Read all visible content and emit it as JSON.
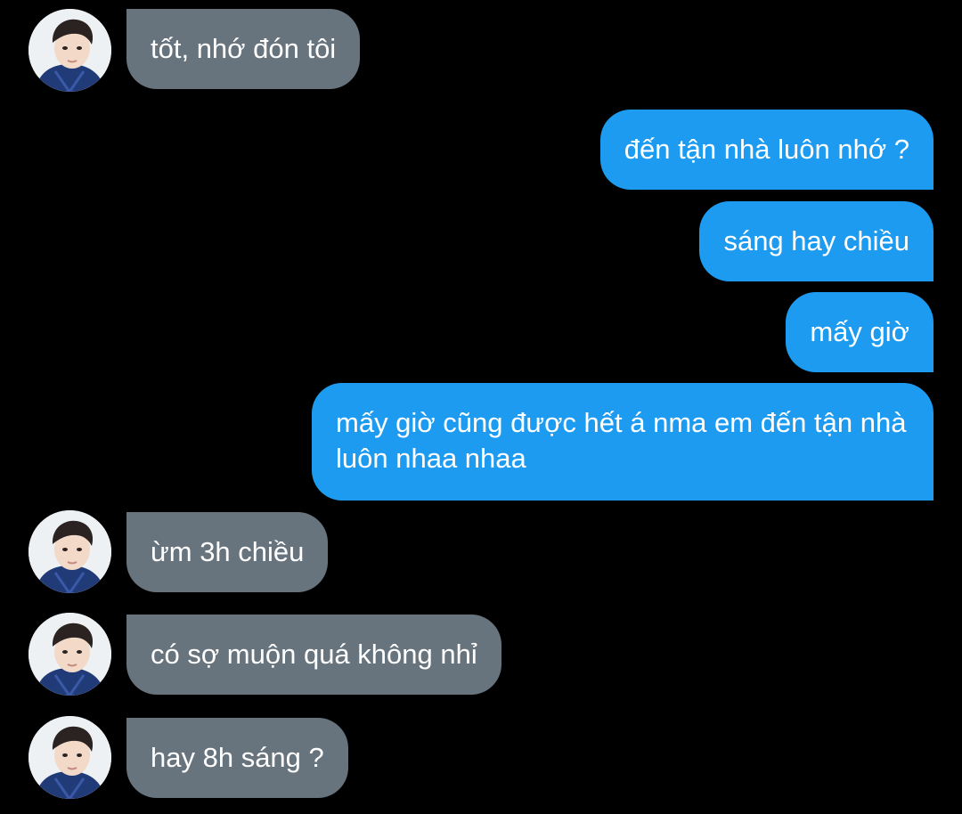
{
  "colors": {
    "background": "#000000",
    "incoming_bubble": "#67737d",
    "outgoing_bubble": "#1d9bf0",
    "text": "#ffffff"
  },
  "contact": {
    "avatar_icon": "contact-avatar-photo"
  },
  "messages": [
    {
      "direction": "incoming",
      "text": "tốt, nhớ đón tôi"
    },
    {
      "direction": "outgoing",
      "text": "đến tận nhà luôn nhớ ?"
    },
    {
      "direction": "outgoing",
      "text": "sáng hay chiều"
    },
    {
      "direction": "outgoing",
      "text": "mấy giờ"
    },
    {
      "direction": "outgoing",
      "text": "mấy giờ cũng được hết á nma em đến tận nhà luôn nhaa nhaa"
    },
    {
      "direction": "incoming",
      "text": "ừm 3h chiều"
    },
    {
      "direction": "incoming",
      "text": "có sợ muộn quá không nhỉ"
    },
    {
      "direction": "incoming",
      "text": "hay 8h sáng ?"
    }
  ]
}
